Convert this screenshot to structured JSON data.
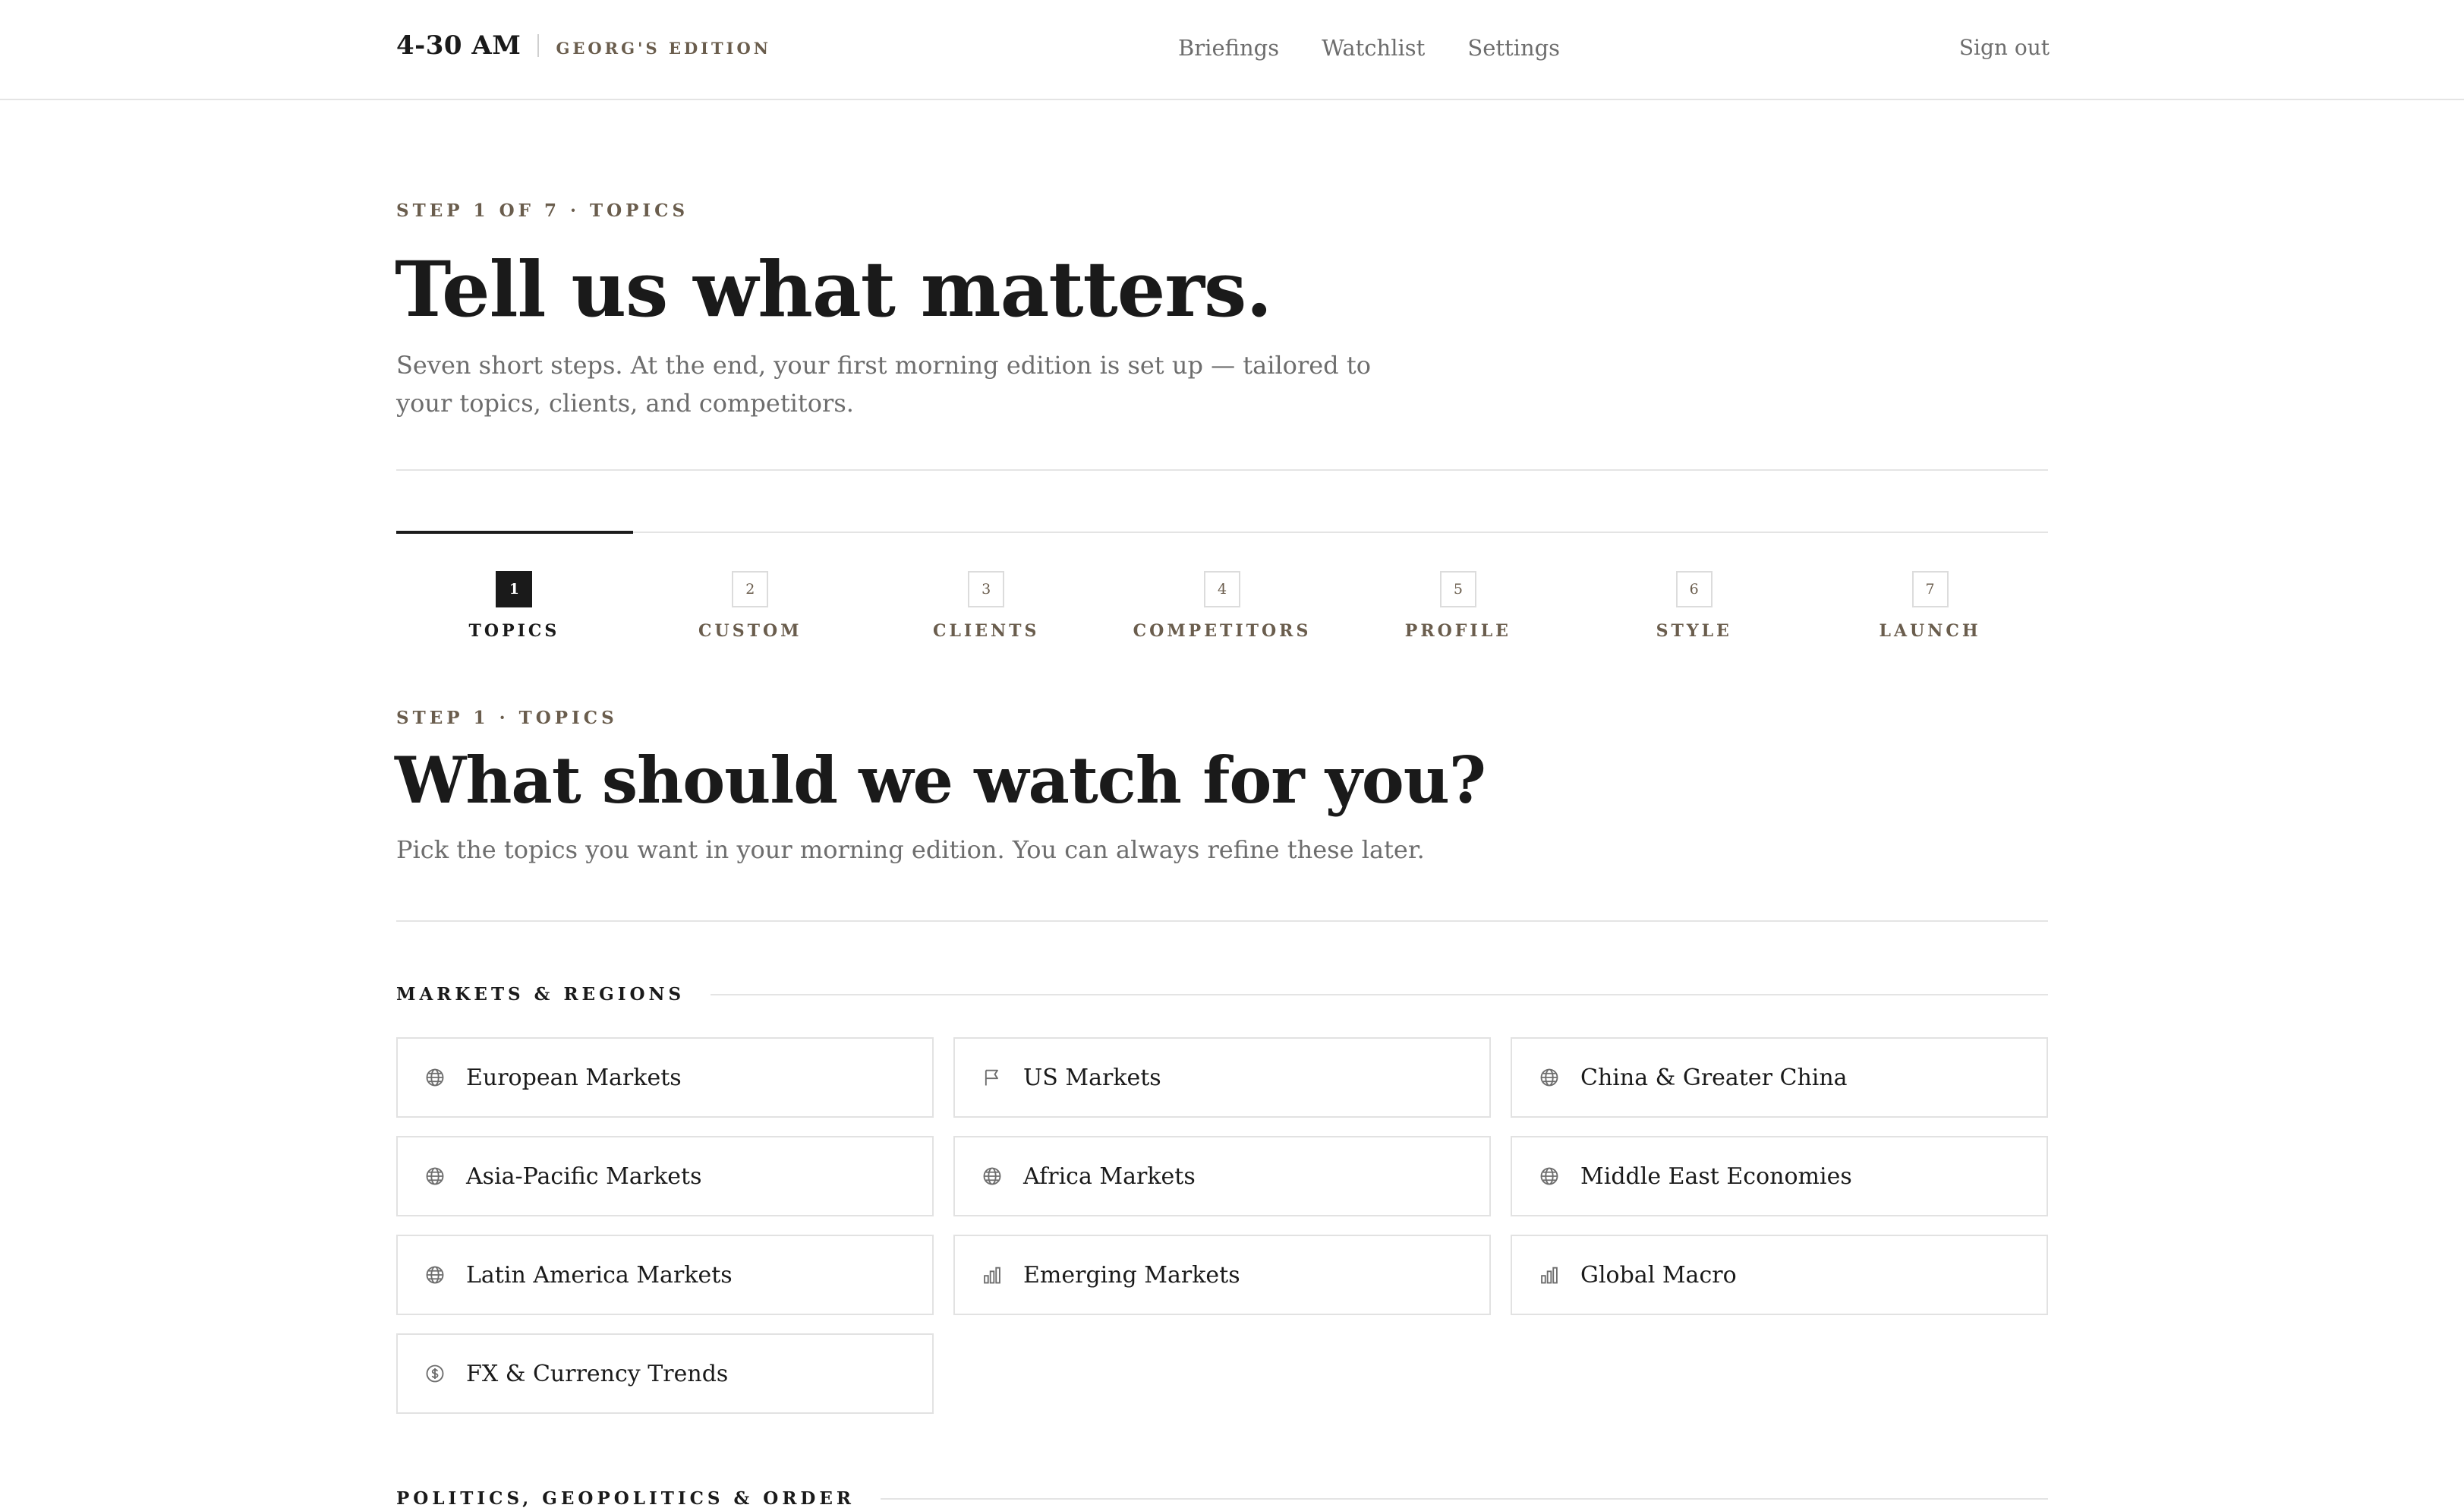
{
  "header": {
    "logo": "4-30 AM",
    "edition": "GEORG'S EDITION",
    "nav": [
      "Briefings",
      "Watchlist",
      "Settings"
    ],
    "signout": "Sign out"
  },
  "hero": {
    "eyebrow": "STEP 1 OF 7 · TOPICS",
    "title": "Tell us what matters.",
    "description": "Seven short steps. At the end, your first morning edition is set up — tailored to your topics, clients, and competitors."
  },
  "stepper": {
    "active_index": 0,
    "steps": [
      {
        "num": "1",
        "label": "TOPICS"
      },
      {
        "num": "2",
        "label": "CUSTOM"
      },
      {
        "num": "3",
        "label": "CLIENTS"
      },
      {
        "num": "4",
        "label": "COMPETITORS"
      },
      {
        "num": "5",
        "label": "PROFILE"
      },
      {
        "num": "6",
        "label": "STYLE"
      },
      {
        "num": "7",
        "label": "LAUNCH"
      }
    ]
  },
  "section": {
    "eyebrow": "STEP 1 · TOPICS",
    "title": "What should we watch for you?",
    "description": "Pick the topics you want in your morning edition. You can always refine these later."
  },
  "groups": [
    {
      "label": "MARKETS & REGIONS",
      "topics": [
        {
          "label": "European Markets",
          "icon": "globe-icon"
        },
        {
          "label": "US Markets",
          "icon": "flag-icon"
        },
        {
          "label": "China & Greater China",
          "icon": "globe-icon"
        },
        {
          "label": "Asia-Pacific Markets",
          "icon": "globe-icon"
        },
        {
          "label": "Africa Markets",
          "icon": "globe-icon"
        },
        {
          "label": "Middle East Economies",
          "icon": "globe-icon"
        },
        {
          "label": "Latin America Markets",
          "icon": "globe-icon"
        },
        {
          "label": "Emerging Markets",
          "icon": "bar-chart-icon"
        },
        {
          "label": "Global Macro",
          "icon": "bar-chart-icon"
        },
        {
          "label": "FX & Currency Trends",
          "icon": "dollar-icon"
        }
      ]
    },
    {
      "label": "POLITICS, GEOPOLITICS & ORDER",
      "topics": []
    }
  ]
}
